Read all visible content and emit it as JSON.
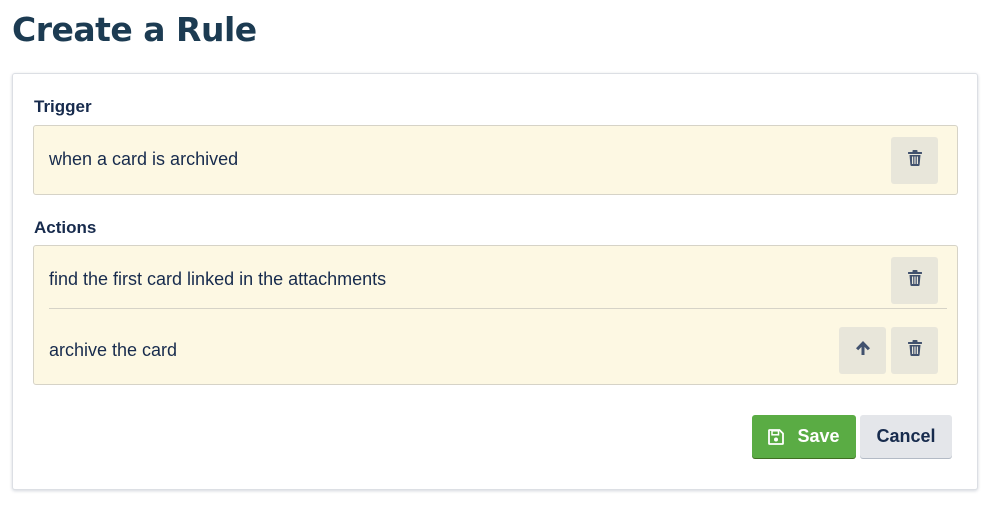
{
  "page": {
    "title": "Create a Rule"
  },
  "trigger": {
    "label": "Trigger",
    "text": "when a card is archived",
    "delete_icon": "trash-icon"
  },
  "actions": {
    "label": "Actions",
    "items": [
      {
        "text": "find the first card linked in the attachments",
        "icons": [
          "trash-icon"
        ]
      },
      {
        "text": "archive the card",
        "icons": [
          "arrow-up-icon",
          "trash-icon"
        ]
      }
    ]
  },
  "buttons": {
    "save_label": "Save",
    "save_icon": "floppy-disk-icon",
    "cancel_label": "Cancel"
  },
  "colors": {
    "title": "#1c3b52",
    "rule_box_bg": "#fdf8e3",
    "icon_button_bg": "#e8e6da",
    "save_bg": "#5aac44",
    "cancel_bg": "#e4e6ea"
  }
}
